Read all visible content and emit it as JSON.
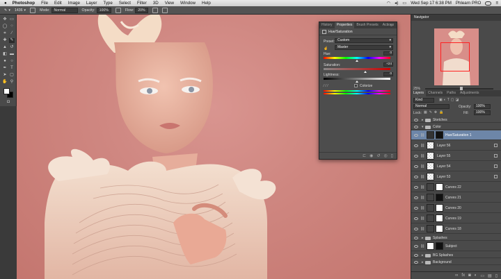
{
  "menubar": {
    "apple": "",
    "app": "Photoshop",
    "items": [
      "File",
      "Edit",
      "Image",
      "Layer",
      "Type",
      "Select",
      "Filter",
      "3D",
      "View",
      "Window",
      "Help"
    ],
    "clock": "Wed Sep 17  6:38 PM",
    "user": "Phlearn PRO"
  },
  "options": {
    "brush_size": "1436",
    "mode_label": "Mode:",
    "mode_value": "Normal",
    "opacity_label": "Opacity:",
    "opacity_value": "100%",
    "flow_label": "Flow:",
    "flow_value": "20%"
  },
  "properties": {
    "tabs": [
      "History",
      "Properties",
      "Brush Presets",
      "Actions"
    ],
    "active_tab": 1,
    "title": "Hue/Saturation",
    "preset_label": "Preset:",
    "preset_value": "Custom",
    "channel_value": "Master",
    "hue_label": "Hue:",
    "hue_value": "0",
    "hue_level": 0.5,
    "saturation_label": "Saturation:",
    "saturation_value": "+24",
    "saturation_level": 0.62,
    "lightness_label": "Lightness:",
    "lightness_value": "0",
    "lightness_level": 0.5,
    "colorize_label": "Colorize"
  },
  "navigator": {
    "tab": "Navigator",
    "zoom": "25%"
  },
  "layers_panel": {
    "tabs": [
      "Layers",
      "Channels",
      "Paths",
      "Adjustments"
    ],
    "kind_label": "Kind",
    "blend_mode": "Normal",
    "opacity_label": "Opacity:",
    "opacity_value": "100%",
    "lock_label": "Lock:",
    "fill_label": "Fill:",
    "fill_value": "100%",
    "layers": [
      {
        "name": "Sketches",
        "type": "group"
      },
      {
        "name": "Color",
        "type": "group-open"
      },
      {
        "name": "Hue/Saturation 1",
        "type": "adjustment",
        "selected": true
      },
      {
        "name": "Layer 56",
        "type": "pixel"
      },
      {
        "name": "Layer 55",
        "type": "pixel"
      },
      {
        "name": "Layer 54",
        "type": "pixel"
      },
      {
        "name": "Layer 53",
        "type": "pixel"
      },
      {
        "name": "Curves 22",
        "type": "curves"
      },
      {
        "name": "Curves 21",
        "type": "curves"
      },
      {
        "name": "Curves 20",
        "type": "curves"
      },
      {
        "name": "Curves 19",
        "type": "curves"
      },
      {
        "name": "Curves 18",
        "type": "curves"
      },
      {
        "name": "Splashes",
        "type": "group"
      },
      {
        "name": "Subject",
        "type": "subject"
      },
      {
        "name": "BG Splashes",
        "type": "group"
      },
      {
        "name": "Background",
        "type": "group"
      }
    ]
  }
}
